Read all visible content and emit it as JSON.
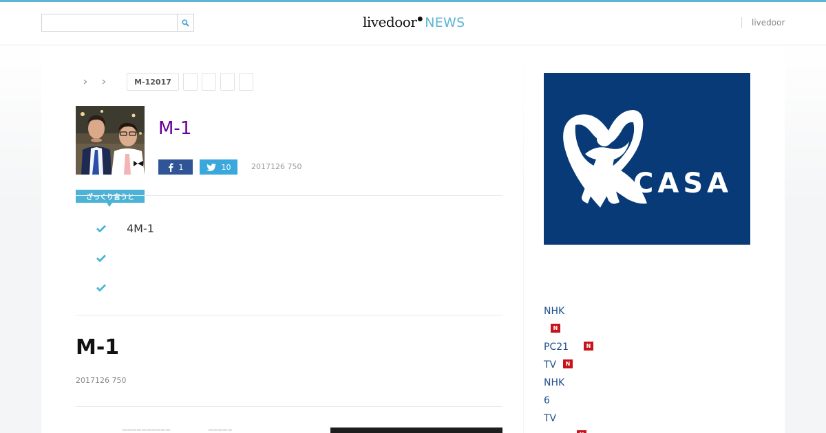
{
  "header": {
    "search_placeholder": "",
    "logo_main": "livedoor",
    "logo_news": "NEWS",
    "right_link": "livedoor"
  },
  "breadcrumb": {
    "tags": [
      "M-12017",
      "",
      "",
      "",
      ""
    ]
  },
  "article": {
    "title_top": "M-1",
    "fb_count": "1",
    "tw_count": "10",
    "date": "2017126 750",
    "summary_label": "ざっくり言うと",
    "summary_items": [
      "4M-1",
      "",
      ""
    ],
    "title_main": "M-1",
    "date_main": "2017126 750"
  },
  "sidebar": {
    "ad_text": "CASA",
    "links": [
      {
        "label": "NHK"
      },
      {
        "label": ""
      },
      {
        "label": "PC21"
      },
      {
        "label": "TV"
      },
      {
        "label": "NHK"
      },
      {
        "label": "6"
      },
      {
        "label": " TV"
      }
    ],
    "new_label": "N"
  },
  "colors": {
    "accent": "#5bb6d5",
    "facebook": "#2f5597",
    "twitter": "#3aa8dd",
    "ad_bg": "#073a76",
    "new_badge": "#c7141c",
    "visited_title": "#660099"
  }
}
